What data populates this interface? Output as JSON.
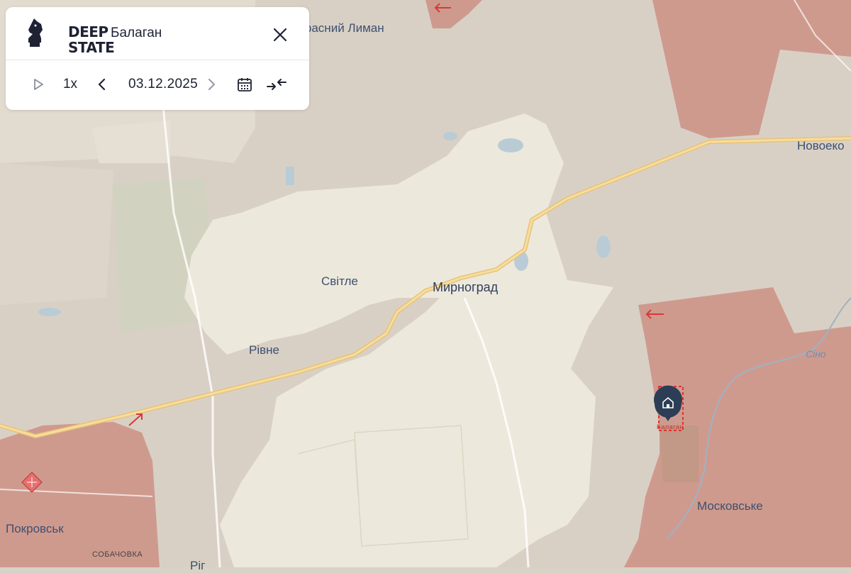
{
  "panel": {
    "logo_line1": "DEEP",
    "logo_line2": "STATE",
    "title": "Балаган",
    "speed": "1x",
    "date": "03.12.2025"
  },
  "icons": {
    "close": "close-icon",
    "play": "play-icon",
    "prev": "chevron-left-icon",
    "next": "chevron-right-icon",
    "calendar": "calendar-icon",
    "collapse": "collapse-arrows-icon",
    "marker": "house-marker-icon"
  },
  "colors": {
    "occupied": "#cf9a8e",
    "grey_zone": "#d7cdc3",
    "free": "#ede8dc",
    "road": "#f2d58a",
    "arrow": "#d33a3a",
    "marker": "#2c3e55"
  },
  "map": {
    "places": {
      "krasny_lyman": "Красний Лиман",
      "novoekonomichne": "Новоеко",
      "svitle": "Світле",
      "myrnohrad": "Мирноград",
      "rivne": "Рівне",
      "pokrovsk": "Покровськ",
      "sobachovka": "СОБАЧОВКА",
      "moskovske": "Московське",
      "balagan_marker": "Балаган",
      "river": "Сіно",
      "bottom_partial": "Ріг"
    }
  }
}
